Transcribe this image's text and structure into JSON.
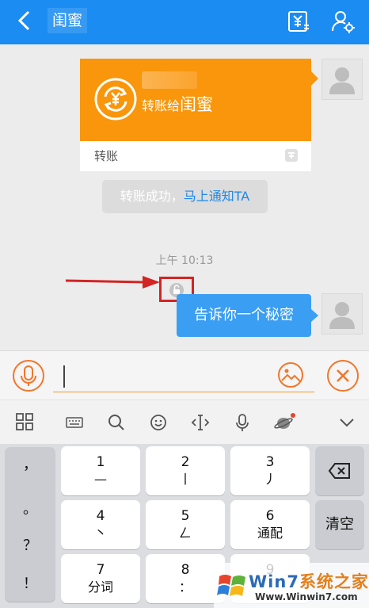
{
  "header": {
    "title": "闺蜜",
    "back_icon": "back-chevron-icon",
    "transfer_icon": "yuan-transfer-icon",
    "settings_icon": "user-settings-icon",
    "bg_color": "#1b8cf2"
  },
  "chat": {
    "transfer_card": {
      "label_prefix": "转账给",
      "recipient": "闺蜜",
      "footer": "转账",
      "icon": "yuan-exchange-icon",
      "footer_icon": "app-badge-icon",
      "color": "#f9960b"
    },
    "system_notice": {
      "text": "转账成功，",
      "link": "马上通知TA"
    },
    "timestamp": "上午 10:13",
    "message": {
      "text": "告诉你一个秘密",
      "lock_icon": "lock-icon",
      "color": "#3a9ef3"
    },
    "highlight_color": "#d32424"
  },
  "inputbar": {
    "voice_icon": "microphone-icon",
    "image_icon": "image-emoji-icon",
    "close_icon": "close-icon",
    "accent": "#f19a2c"
  },
  "keyboard_toolbar": {
    "icons": [
      "grid-icon",
      "keyboard-icon",
      "search-icon",
      "emoji-icon",
      "cursor-icon",
      "microphone-icon",
      "skin-icon",
      "collapse-chevron-icon"
    ]
  },
  "keyboard": {
    "left_column": [
      "，",
      "。",
      "？",
      "！"
    ],
    "keys": [
      {
        "num": "1",
        "sub": "—"
      },
      {
        "num": "2",
        "sub": "丨"
      },
      {
        "num": "3",
        "sub": "丿"
      },
      {
        "num": "4",
        "sub": "丶"
      },
      {
        "num": "5",
        "sub": "𠃋"
      },
      {
        "num": "6",
        "sub": "通配"
      },
      {
        "num": "7",
        "sub": "分词"
      },
      {
        "num": "8",
        "sub": "："
      },
      {
        "num": "9",
        "sub": ""
      }
    ],
    "backspace_icon": "backspace-icon",
    "clear_label": "清空"
  },
  "watermark": {
    "brand_win": "Win",
    "brand_7": "7",
    "brand_sys": "系统之家",
    "url": "Www.Winwin7.com"
  }
}
